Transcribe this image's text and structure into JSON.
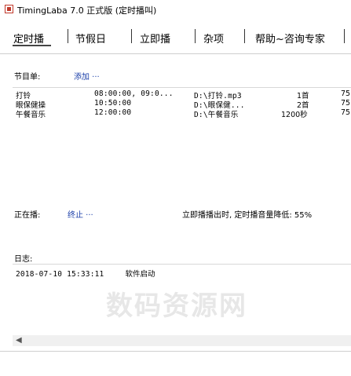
{
  "window": {
    "title": "TimingLaba 7.0 正式版 (定时播叫)"
  },
  "menu": [
    "定时播",
    "节假日",
    "立即播",
    "杂项",
    "帮助~咨询专家"
  ],
  "schedule": {
    "label": "节目单:",
    "add_link": "添加 ···",
    "rows": [
      {
        "name": "打铃",
        "time": "08:00:00, 09:0...",
        "path": "D:\\打铃.mp3",
        "count": "1首",
        "vol": "75"
      },
      {
        "name": "眼保健操",
        "time": "10:50:00",
        "path": "D:\\眼保健...",
        "count": "2首",
        "vol": "75"
      },
      {
        "name": "午餐音乐",
        "time": "12:00:00",
        "path": "D:\\午餐音乐",
        "count": "1200秒",
        "vol": "75"
      }
    ]
  },
  "playing": {
    "label": "正在播:",
    "stop_link": "终止 ···",
    "status": "立即播播出时, 定时播音量降低: 55%"
  },
  "log": {
    "label": "日志:",
    "entries": [
      {
        "time": "2018-07-10 15:33:11",
        "message": "软件启动"
      }
    ]
  },
  "watermark": "数码资源网"
}
